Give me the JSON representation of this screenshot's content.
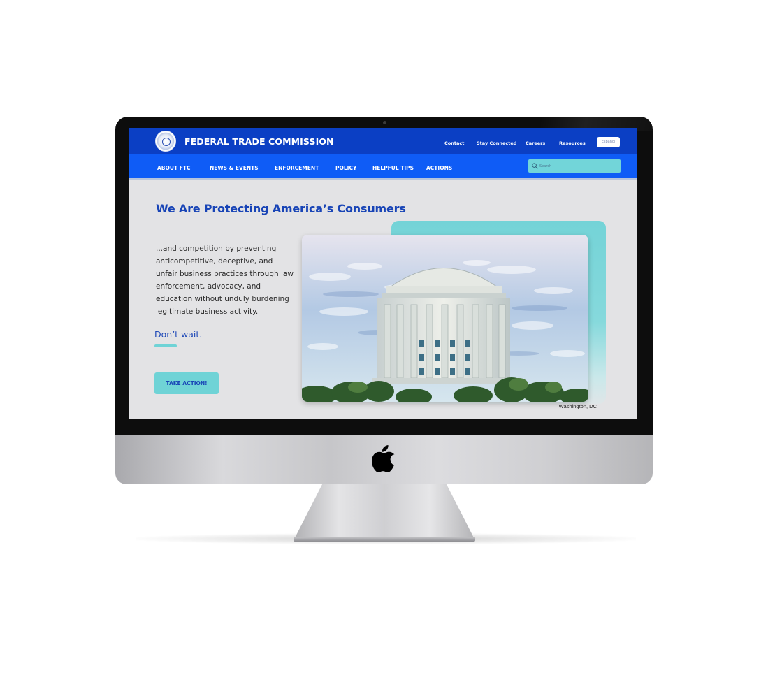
{
  "site": {
    "agency_name": "FEDERAL TRADE COMMISSION",
    "utility_links": [
      "Contact",
      "Stay Connected",
      "Careers",
      "Resources"
    ],
    "language_button": "Español",
    "nav_items": [
      "ABOUT FTC",
      "NEWS & EVENTS",
      "ENFORCEMENT",
      "POLICY",
      "HELPFUL TIPS",
      "ACTIONS"
    ],
    "search": {
      "placeholder": "Search",
      "value": ""
    }
  },
  "hero": {
    "title": "We Are Protecting America’s Consumers",
    "body": "...and competition by preventing anticompetitive, deceptive, and unfair business practices through law enforcement, advocacy, and education without unduly burdening legitimate business activity.",
    "tagline": "Don’t wait.",
    "cta_label": "TAKE ACTION!",
    "image_caption": "Washington, DC"
  },
  "colors": {
    "top_bar": "#0b3fc4",
    "nav_bar": "#0f5cf6",
    "accent_teal": "#6fd3d6",
    "heading_blue": "#1844b6",
    "page_bg": "#e3e3e5"
  },
  "icons": {
    "seal": "ftc-seal-icon",
    "search": "search-icon",
    "device_logo": "apple-logo-icon"
  }
}
